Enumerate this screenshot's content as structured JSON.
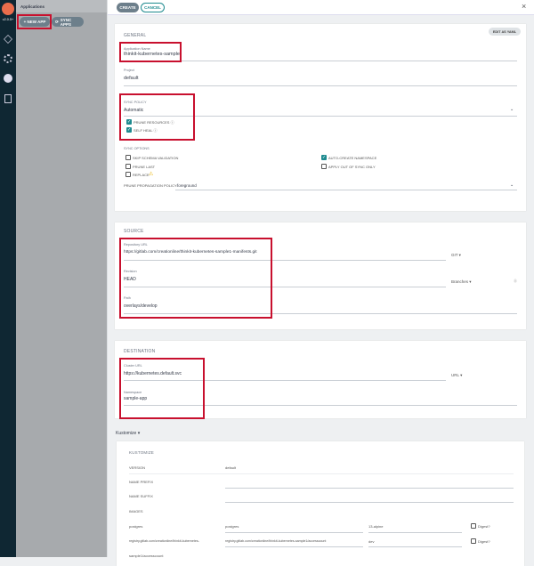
{
  "nav": {
    "version": "v2.0.5+",
    "items": [
      "applications-icon",
      "settings-icon",
      "user-icon",
      "docs-icon"
    ]
  },
  "applist": {
    "title": "Applications",
    "new_app": "+ NEW APP",
    "sync_apps": "SYNC APPS"
  },
  "toolbar": {
    "create": "CREATE",
    "cancel": "CANCEL",
    "close": "×"
  },
  "general": {
    "title": "GENERAL",
    "edit_yaml": "EDIT AS YAML",
    "app_name_label": "Application Name",
    "app_name": "thinkit-kubernetes-sample",
    "project_label": "Project",
    "project": "default",
    "sync_policy_label": "SYNC POLICY",
    "sync_policy": "Automatic",
    "prune_resources": "PRUNE RESOURCES ⓘ",
    "self_heal": "SELF HEAL ⓘ",
    "sync_options_label": "SYNC OPTIONS",
    "skip_schema": "SKIP SCHEMA VALIDATION",
    "prune_last": "PRUNE LAST",
    "replace": "REPLACE",
    "auto_create_ns": "AUTO-CREATE NAMESPACE",
    "apply_out_of_sync": "APPLY OUT OF SYNC ONLY",
    "prune_propagation_label": "PRUNE PROPAGATION POLICY:",
    "prune_propagation": "foreground"
  },
  "source": {
    "title": "SOURCE",
    "repo_label": "Repository URL",
    "repo": "https://gitlab.com/creationline/thinkit-kubernetes-sample1-manifests.git",
    "repo_type": "GIT ▾",
    "revision_label": "Revision",
    "revision": "HEAD",
    "revision_type": "Branches ▾",
    "path_label": "Path",
    "path": "overlays/develop"
  },
  "destination": {
    "title": "DESTINATION",
    "cluster_label": "Cluster URL",
    "cluster": "https://kubernetes.default.svc",
    "cluster_type": "URL ▾",
    "namespace_label": "Namespace",
    "namespace": "sample-app"
  },
  "kustomize": {
    "toggle": "Kustomize ▾",
    "title": "KUSTOMIZE",
    "version_label": "VERSION",
    "version": "default",
    "name_prefix": "NAME PREFIX",
    "name_suffix": "NAME SUFFIX",
    "images_label": "IMAGES",
    "images": [
      {
        "name": "postgres",
        "image": "postgres",
        "tag": "13-alpine",
        "digest": "Digest?"
      },
      {
        "name": "registry.gitlab.com/creationline/thinkit-kubernetes-",
        "image": "registry.gitlab.com/creationline/thinkit-kubernetes-sample1/accesscount",
        "tag": "dev",
        "digest": "Digest?"
      }
    ],
    "name_cont": "sample1/accesscount"
  }
}
